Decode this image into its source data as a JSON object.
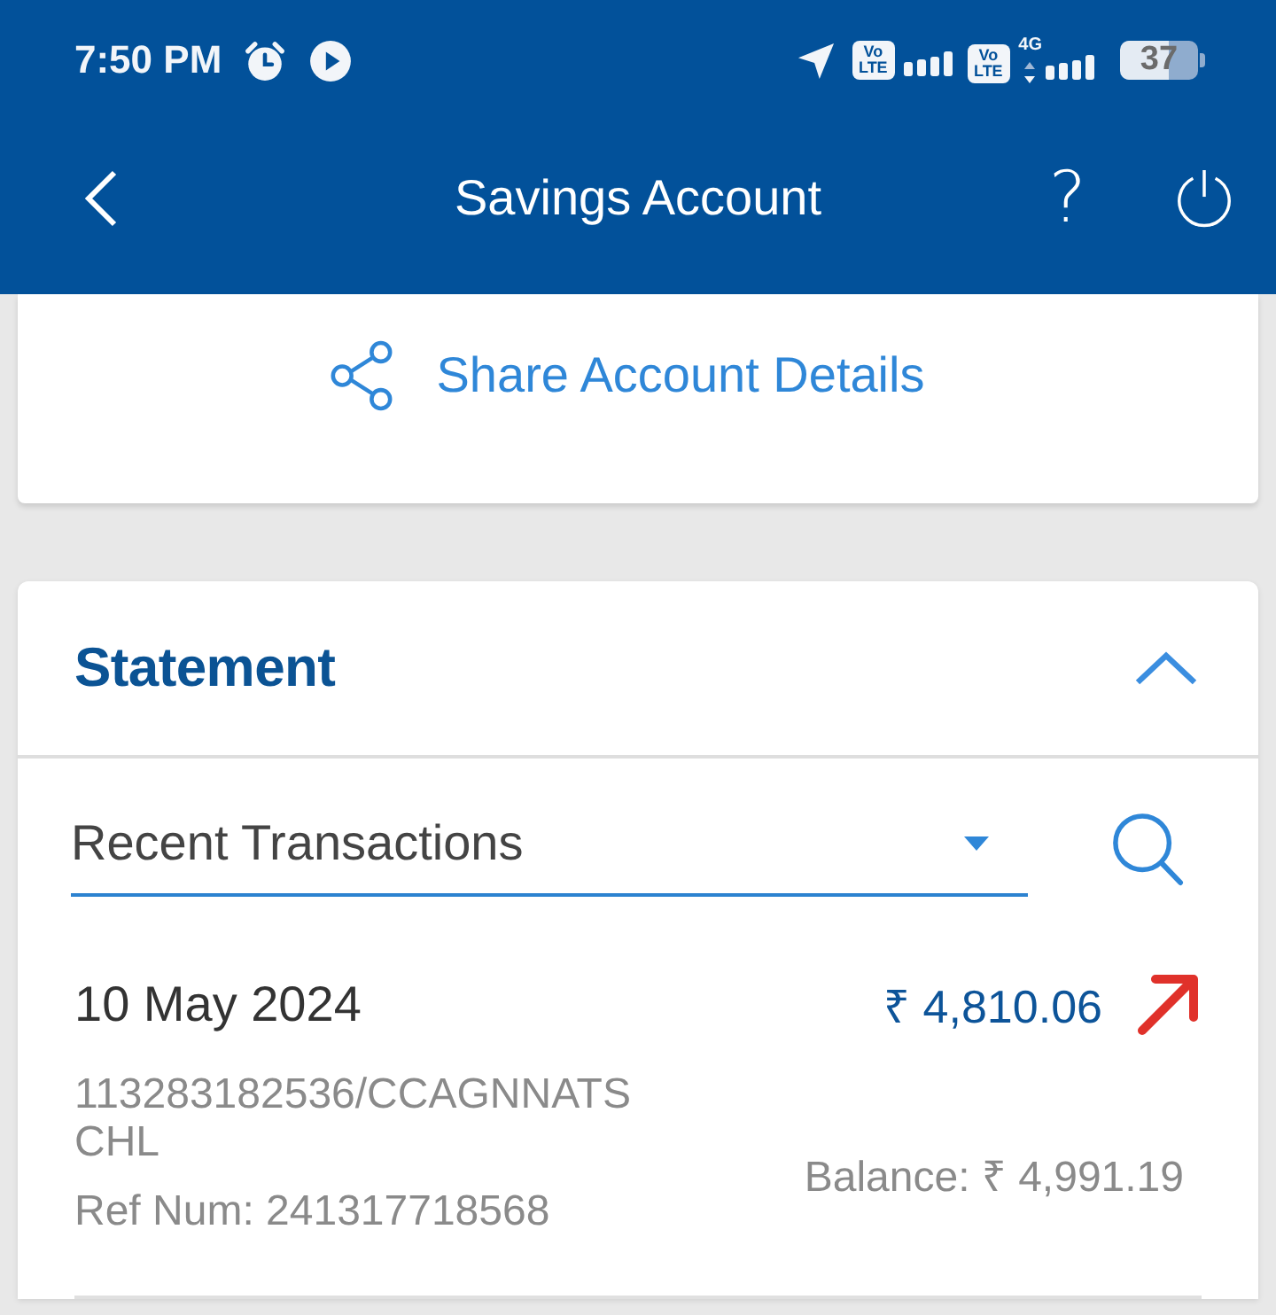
{
  "status_bar": {
    "time": "7:50 PM",
    "sims": [
      {
        "badge": "Vo LTE"
      },
      {
        "badge": "Vo LTE",
        "network": "4G"
      }
    ],
    "battery": "37"
  },
  "header": {
    "title": "Savings Account",
    "help": "?"
  },
  "share": {
    "label": "Share Account Details"
  },
  "statement": {
    "title": "Statement",
    "expanded": true,
    "filter": {
      "value": "Recent Transactions"
    },
    "transactions": [
      {
        "date": "10 May 2024",
        "amount": "₹ 4,810.06",
        "kind": "debit",
        "description": "113283182536/CCAGNNATS CHL",
        "ref": "Ref Num: 241317718568",
        "balance": "Balance: ₹ 4,991.19"
      }
    ]
  }
}
